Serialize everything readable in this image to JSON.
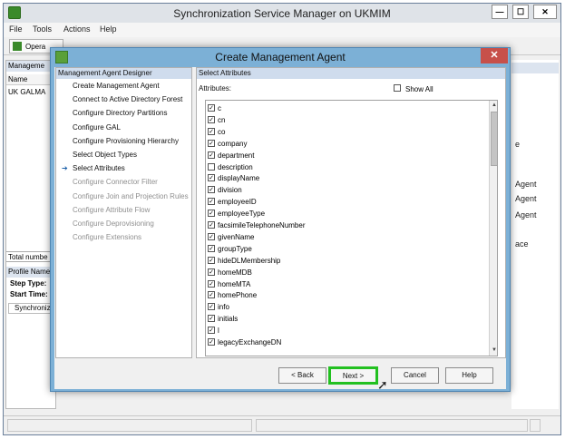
{
  "window": {
    "title": "Synchronization Service Manager on UKMIM",
    "min": "—",
    "max": "☐",
    "close": "✕"
  },
  "menu": [
    "File",
    "Tools",
    "Actions",
    "Help"
  ],
  "toolbar": {
    "operations_label": "Opera"
  },
  "left_pane": {
    "header": "Manageme",
    "column": "Name",
    "row": "UK GALMA",
    "total": "Total numbe",
    "profile": "Profile Name",
    "step_type": "Step Type:",
    "start_time": "Start Time:",
    "sync": "Synchroniz"
  },
  "right_pane": {
    "texts": [
      "e",
      "Agent",
      "Agent",
      "Agent",
      "ace"
    ]
  },
  "dialog": {
    "title": "Create Management Agent",
    "close": "✕",
    "designer_header": "Management Agent Designer",
    "steps": [
      {
        "label": "Create Management Agent",
        "enabled": true
      },
      {
        "label": "Connect to Active Directory Forest",
        "enabled": true
      },
      {
        "label": "Configure Directory Partitions",
        "enabled": true
      },
      {
        "label": "Configure GAL",
        "enabled": true
      },
      {
        "label": "Configure Provisioning Hierarchy",
        "enabled": true
      },
      {
        "label": "Select Object Types",
        "enabled": true
      },
      {
        "label": "Select Attributes",
        "enabled": true,
        "current": true
      },
      {
        "label": "Configure Connector Filter",
        "enabled": false
      },
      {
        "label": "Configure Join and Projection Rules",
        "enabled": false
      },
      {
        "label": "Configure Attribute Flow",
        "enabled": false
      },
      {
        "label": "Configure Deprovisioning",
        "enabled": false
      },
      {
        "label": "Configure Extensions",
        "enabled": false
      }
    ],
    "current_arrow": "➔",
    "attributes_header": "Select Attributes",
    "attributes_label": "Attributes:",
    "show_all": "Show All",
    "attributes": [
      {
        "name": "c",
        "checked": true
      },
      {
        "name": "cn",
        "checked": true
      },
      {
        "name": "co",
        "checked": true
      },
      {
        "name": "company",
        "checked": true
      },
      {
        "name": "department",
        "checked": true
      },
      {
        "name": "description",
        "checked": false
      },
      {
        "name": "displayName",
        "checked": true
      },
      {
        "name": "division",
        "checked": true
      },
      {
        "name": "employeeID",
        "checked": true
      },
      {
        "name": "employeeType",
        "checked": true
      },
      {
        "name": "facsimileTelephoneNumber",
        "checked": true
      },
      {
        "name": "givenName",
        "checked": true
      },
      {
        "name": "groupType",
        "checked": true
      },
      {
        "name": "hideDLMembership",
        "checked": true
      },
      {
        "name": "homeMDB",
        "checked": true
      },
      {
        "name": "homeMTA",
        "checked": true
      },
      {
        "name": "homePhone",
        "checked": true
      },
      {
        "name": "info",
        "checked": true
      },
      {
        "name": "initials",
        "checked": true
      },
      {
        "name": "l",
        "checked": true
      },
      {
        "name": "legacyExchangeDN",
        "checked": true
      }
    ],
    "buttons": {
      "back": "< Back",
      "next": "Next >",
      "cancel": "Cancel",
      "help": "Help"
    }
  },
  "check_mark": "✓",
  "accent_green": "#22c020"
}
